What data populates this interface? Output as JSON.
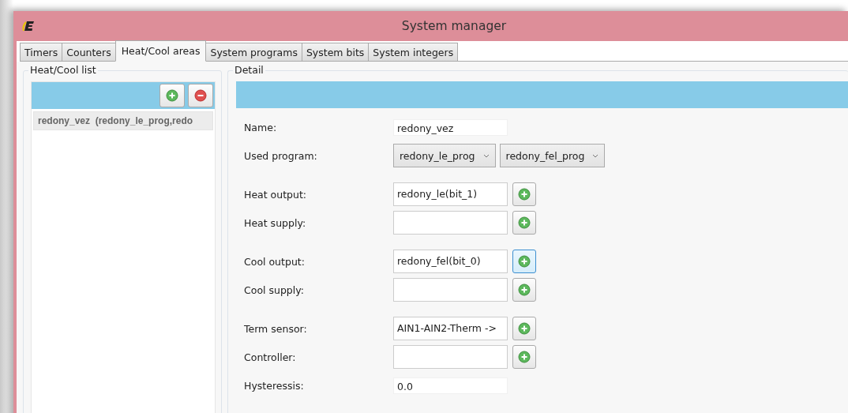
{
  "window": {
    "title": "System manager"
  },
  "tabs": [
    {
      "label": "Timers",
      "selected": false
    },
    {
      "label": "Counters",
      "selected": false
    },
    {
      "label": "Heat/Cool areas",
      "selected": true
    },
    {
      "label": "System programs",
      "selected": false
    },
    {
      "label": "System bits",
      "selected": false
    },
    {
      "label": "System integers",
      "selected": false
    }
  ],
  "list_panel": {
    "title": "Heat/Cool list",
    "items": [
      {
        "label": "redony_vez  (redony_le_prog,redo",
        "selected": true
      }
    ]
  },
  "detail": {
    "title": "Detail",
    "sections": [
      [
        {
          "kind": "text",
          "label": "Name:",
          "value": "redony_vez"
        },
        {
          "kind": "combos",
          "label": "Used program:",
          "values": [
            "redony_le_prog",
            "redony_fel_prog"
          ]
        }
      ],
      [
        {
          "kind": "picker",
          "label": "Heat output:",
          "value": "redony_le(bit_1)",
          "focused": false
        },
        {
          "kind": "picker",
          "label": "Heat supply:",
          "focused": false
        }
      ],
      [
        {
          "kind": "picker",
          "label": "Cool output:",
          "value": "redony_fel(bit_0)",
          "focused": true
        },
        {
          "kind": "picker",
          "label": "Cool supply:",
          "focused": false
        }
      ],
      [
        {
          "kind": "picker",
          "label": "Term sensor:",
          "value": "AIN1-AIN2-Therm ->",
          "focused": false
        },
        {
          "kind": "picker",
          "label": "Controller:",
          "focused": false
        },
        {
          "kind": "text",
          "label": "Hysteressis:",
          "value": "0.0"
        }
      ]
    ]
  }
}
